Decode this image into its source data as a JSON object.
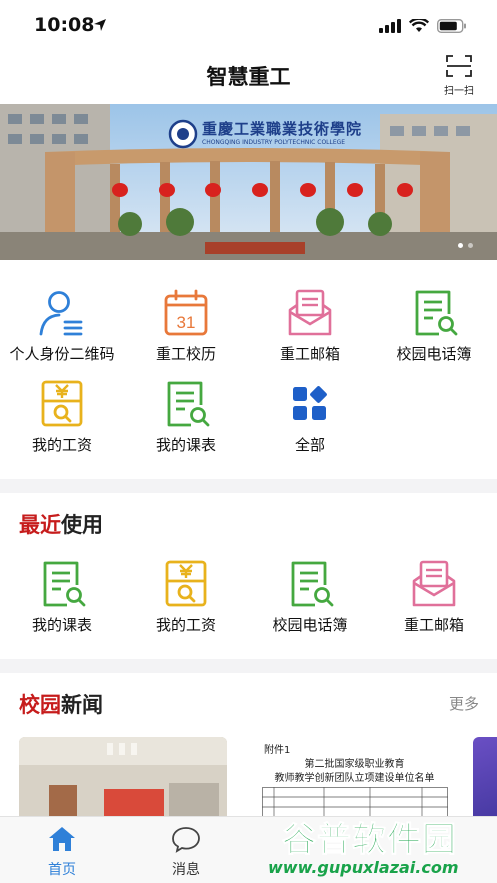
{
  "status": {
    "time": "10:08"
  },
  "nav": {
    "title": "智慧重工",
    "scan_label": "扫一扫"
  },
  "banner": {
    "college_name_cn": "重慶工業職業技術學院",
    "college_name_en": "CHONGQING INDUSTRY POLYTECHNIC COLLEGE",
    "slides": 2,
    "active_slide": 0
  },
  "apps": [
    {
      "label": "个人身份二维码",
      "icon": "person-qrcode-icon",
      "color": "#2f80d8"
    },
    {
      "label": "重工校历",
      "icon": "calendar-icon",
      "color": "#e8783a",
      "day": "31"
    },
    {
      "label": "重工邮箱",
      "icon": "mail-icon",
      "color": "#e0709a"
    },
    {
      "label": "校园电话簿",
      "icon": "phonebook-icon",
      "color": "#45a840"
    },
    {
      "label": "我的工资",
      "icon": "salary-icon",
      "color": "#e8b21c"
    },
    {
      "label": "我的课表",
      "icon": "timetable-icon",
      "color": "#45a840"
    },
    {
      "label": "全部",
      "icon": "all-apps-icon",
      "color": "#1e5fc8"
    }
  ],
  "recent": {
    "title_highlight": "最近",
    "title_rest": "使用",
    "items": [
      {
        "label": "我的课表",
        "icon": "timetable-icon",
        "color": "#45a840"
      },
      {
        "label": "我的工资",
        "icon": "salary-icon",
        "color": "#e8b21c"
      },
      {
        "label": "校园电话簿",
        "icon": "phonebook-icon",
        "color": "#45a840"
      },
      {
        "label": "重工邮箱",
        "icon": "mail-icon",
        "color": "#e0709a"
      }
    ]
  },
  "news": {
    "title_highlight": "校园",
    "title_rest": "新闻",
    "more": "更多",
    "doc_tag": "附件1",
    "doc_heading1": "第二批国家级职业教育",
    "doc_heading2": "教师教学创新团队立项建设单位名单"
  },
  "tabs": [
    {
      "label": "首页",
      "active": true
    },
    {
      "label": "消息",
      "active": false
    }
  ],
  "watermark": {
    "text": "谷普软件园",
    "url": "www.gupuxlazai.com"
  }
}
